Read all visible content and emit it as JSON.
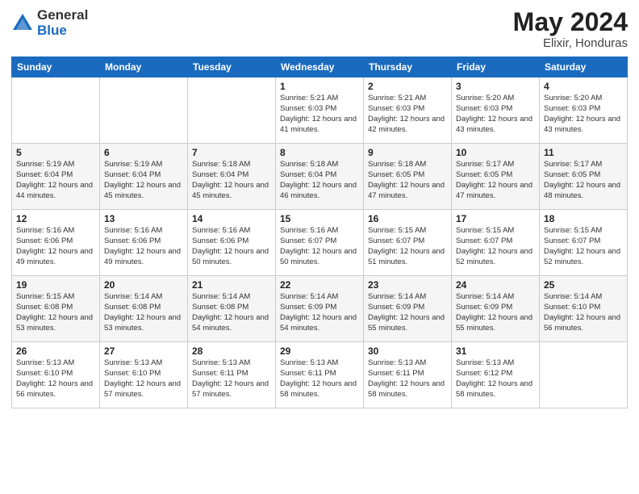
{
  "logo": {
    "general": "General",
    "blue": "Blue"
  },
  "title": {
    "month": "May 2024",
    "location": "Elixir, Honduras"
  },
  "weekdays": [
    "Sunday",
    "Monday",
    "Tuesday",
    "Wednesday",
    "Thursday",
    "Friday",
    "Saturday"
  ],
  "weeks": [
    [
      {
        "day": "",
        "info": ""
      },
      {
        "day": "",
        "info": ""
      },
      {
        "day": "",
        "info": ""
      },
      {
        "day": "1",
        "info": "Sunrise: 5:21 AM\nSunset: 6:03 PM\nDaylight: 12 hours\nand 41 minutes."
      },
      {
        "day": "2",
        "info": "Sunrise: 5:21 AM\nSunset: 6:03 PM\nDaylight: 12 hours\nand 42 minutes."
      },
      {
        "day": "3",
        "info": "Sunrise: 5:20 AM\nSunset: 6:03 PM\nDaylight: 12 hours\nand 43 minutes."
      },
      {
        "day": "4",
        "info": "Sunrise: 5:20 AM\nSunset: 6:03 PM\nDaylight: 12 hours\nand 43 minutes."
      }
    ],
    [
      {
        "day": "5",
        "info": "Sunrise: 5:19 AM\nSunset: 6:04 PM\nDaylight: 12 hours\nand 44 minutes."
      },
      {
        "day": "6",
        "info": "Sunrise: 5:19 AM\nSunset: 6:04 PM\nDaylight: 12 hours\nand 45 minutes."
      },
      {
        "day": "7",
        "info": "Sunrise: 5:18 AM\nSunset: 6:04 PM\nDaylight: 12 hours\nand 45 minutes."
      },
      {
        "day": "8",
        "info": "Sunrise: 5:18 AM\nSunset: 6:04 PM\nDaylight: 12 hours\nand 46 minutes."
      },
      {
        "day": "9",
        "info": "Sunrise: 5:18 AM\nSunset: 6:05 PM\nDaylight: 12 hours\nand 47 minutes."
      },
      {
        "day": "10",
        "info": "Sunrise: 5:17 AM\nSunset: 6:05 PM\nDaylight: 12 hours\nand 47 minutes."
      },
      {
        "day": "11",
        "info": "Sunrise: 5:17 AM\nSunset: 6:05 PM\nDaylight: 12 hours\nand 48 minutes."
      }
    ],
    [
      {
        "day": "12",
        "info": "Sunrise: 5:16 AM\nSunset: 6:06 PM\nDaylight: 12 hours\nand 49 minutes."
      },
      {
        "day": "13",
        "info": "Sunrise: 5:16 AM\nSunset: 6:06 PM\nDaylight: 12 hours\nand 49 minutes."
      },
      {
        "day": "14",
        "info": "Sunrise: 5:16 AM\nSunset: 6:06 PM\nDaylight: 12 hours\nand 50 minutes."
      },
      {
        "day": "15",
        "info": "Sunrise: 5:16 AM\nSunset: 6:07 PM\nDaylight: 12 hours\nand 50 minutes."
      },
      {
        "day": "16",
        "info": "Sunrise: 5:15 AM\nSunset: 6:07 PM\nDaylight: 12 hours\nand 51 minutes."
      },
      {
        "day": "17",
        "info": "Sunrise: 5:15 AM\nSunset: 6:07 PM\nDaylight: 12 hours\nand 52 minutes."
      },
      {
        "day": "18",
        "info": "Sunrise: 5:15 AM\nSunset: 6:07 PM\nDaylight: 12 hours\nand 52 minutes."
      }
    ],
    [
      {
        "day": "19",
        "info": "Sunrise: 5:15 AM\nSunset: 6:08 PM\nDaylight: 12 hours\nand 53 minutes."
      },
      {
        "day": "20",
        "info": "Sunrise: 5:14 AM\nSunset: 6:08 PM\nDaylight: 12 hours\nand 53 minutes."
      },
      {
        "day": "21",
        "info": "Sunrise: 5:14 AM\nSunset: 6:08 PM\nDaylight: 12 hours\nand 54 minutes."
      },
      {
        "day": "22",
        "info": "Sunrise: 5:14 AM\nSunset: 6:09 PM\nDaylight: 12 hours\nand 54 minutes."
      },
      {
        "day": "23",
        "info": "Sunrise: 5:14 AM\nSunset: 6:09 PM\nDaylight: 12 hours\nand 55 minutes."
      },
      {
        "day": "24",
        "info": "Sunrise: 5:14 AM\nSunset: 6:09 PM\nDaylight: 12 hours\nand 55 minutes."
      },
      {
        "day": "25",
        "info": "Sunrise: 5:14 AM\nSunset: 6:10 PM\nDaylight: 12 hours\nand 56 minutes."
      }
    ],
    [
      {
        "day": "26",
        "info": "Sunrise: 5:13 AM\nSunset: 6:10 PM\nDaylight: 12 hours\nand 56 minutes."
      },
      {
        "day": "27",
        "info": "Sunrise: 5:13 AM\nSunset: 6:10 PM\nDaylight: 12 hours\nand 57 minutes."
      },
      {
        "day": "28",
        "info": "Sunrise: 5:13 AM\nSunset: 6:11 PM\nDaylight: 12 hours\nand 57 minutes."
      },
      {
        "day": "29",
        "info": "Sunrise: 5:13 AM\nSunset: 6:11 PM\nDaylight: 12 hours\nand 58 minutes."
      },
      {
        "day": "30",
        "info": "Sunrise: 5:13 AM\nSunset: 6:11 PM\nDaylight: 12 hours\nand 58 minutes."
      },
      {
        "day": "31",
        "info": "Sunrise: 5:13 AM\nSunset: 6:12 PM\nDaylight: 12 hours\nand 58 minutes."
      },
      {
        "day": "",
        "info": ""
      }
    ]
  ]
}
